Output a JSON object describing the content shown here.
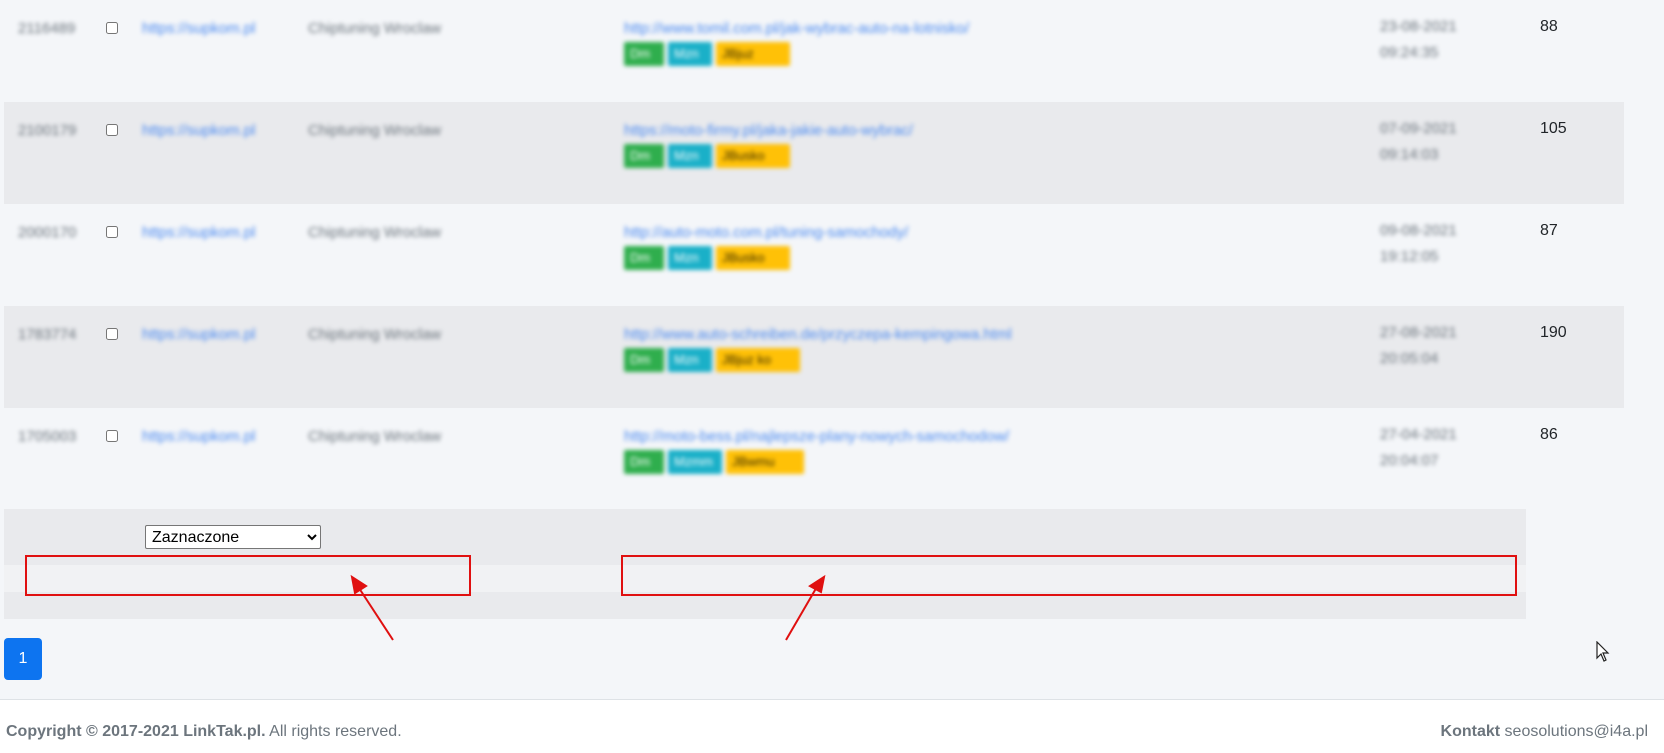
{
  "rows": [
    {
      "id": "2116489",
      "site": "https://supkom.pl",
      "category": "Chiptuning Wroclaw",
      "url": "http://www.tomil.com.pl/jak-wybrac-auto-na-lotnisko/",
      "badges": [
        "Dm",
        "Mzn",
        "JBjuz"
      ],
      "date": "23-08-2021",
      "time": "09:24:35",
      "count": "88"
    },
    {
      "id": "2100179",
      "site": "https://supkom.pl",
      "category": "Chiptuning Wroclaw",
      "url": "https://moto-firmy.pl/jaka-jakie-auto-wybrac/",
      "badges": [
        "Dm",
        "Mzn",
        "JBusko"
      ],
      "date": "07-09-2021",
      "time": "09:14:03",
      "count": "105"
    },
    {
      "id": "2000170",
      "site": "https://supkom.pl",
      "category": "Chiptuning Wroclaw",
      "url": "http://auto-moto.com.pl/tuning-samochody/",
      "badges": [
        "Dm",
        "Mzn",
        "JBusko"
      ],
      "date": "09-08-2021",
      "time": "19:12:05",
      "count": "87"
    },
    {
      "id": "1783774",
      "site": "https://supkom.pl",
      "category": "Chiptuning Wroclaw",
      "url": "http://www.auto-schreiben.de/przyczepa-kempingowa.html",
      "badges": [
        "Dm",
        "Mzn",
        "JBjuz ko"
      ],
      "date": "27-08-2021",
      "time": "20:05:04",
      "count": "190"
    },
    {
      "id": "1705003",
      "site": "https://supkom.pl",
      "category": "Chiptuning Wroclaw",
      "url": "http://moto-bess.pl/najlepsze-plany-nowych-samochodow/",
      "badges": [
        "Dm",
        "Mzmm",
        "JBwmu"
      ],
      "date": "27-04-2021",
      "time": "20:04:07",
      "count": "86"
    }
  ],
  "bulk_select": {
    "selected": "Zaznaczone",
    "options": [
      "Zaznaczone"
    ]
  },
  "pagination": {
    "current": "1"
  },
  "footer": {
    "copyright_prefix": "Copyright © 2017-2021 LinkTak.pl.",
    "copyright_suffix": " All rights reserved.",
    "contact_label": "Kontakt",
    "contact_email": " seosolutions@i4a.pl"
  },
  "colors": {
    "highlight": "#e01010",
    "primary": "#0d74f0",
    "link": "#4b8af0",
    "badge_green": "#2fae4d",
    "badge_cyan": "#1ab0c8",
    "badge_yellow": "#ffc107"
  }
}
